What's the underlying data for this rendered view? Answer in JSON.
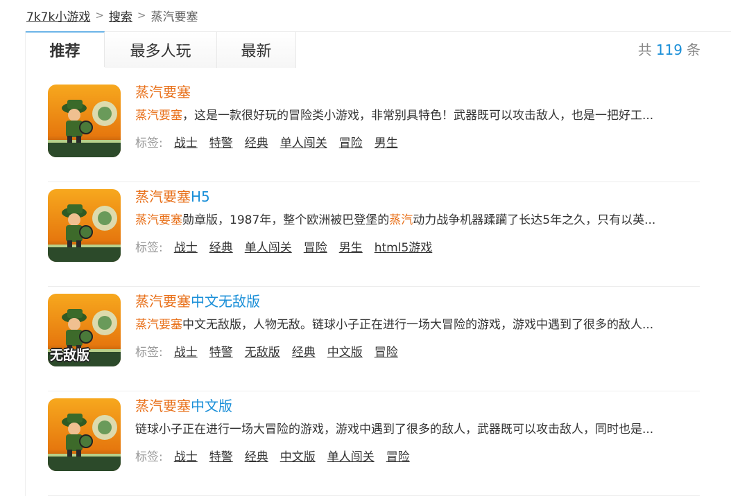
{
  "breadcrumb": {
    "home": "7k7k小游戏",
    "sep": ">",
    "search": "搜索",
    "current": "蒸汽要塞"
  },
  "tabs": [
    {
      "label": "推荐",
      "active": true
    },
    {
      "label": "最多人玩",
      "active": false
    },
    {
      "label": "最新",
      "active": false
    }
  ],
  "result_count": {
    "prefix": "共",
    "value": "119",
    "suffix": "条"
  },
  "tags_label": "标签:",
  "colors": {
    "highlight": "#e8701a",
    "link_blue": "#1a8fd8",
    "tab_accent": "#6cb4e8"
  },
  "games": [
    {
      "title_hl": "蒸汽要塞",
      "title_rest": "",
      "desc_parts": [
        {
          "text": "蒸汽要塞",
          "hl": true
        },
        {
          "text": "，这是一款很好玩的冒险类小游戏，非常别具特色！武器既可以攻击敌人，也是一把好工...",
          "hl": false
        }
      ],
      "tags": [
        "战士",
        "特警",
        "经典",
        "单人闯关",
        "冒险",
        "男生"
      ],
      "badge": ""
    },
    {
      "title_hl": "蒸汽要塞",
      "title_rest": "H5",
      "desc_parts": [
        {
          "text": "蒸汽要塞",
          "hl": true
        },
        {
          "text": "勋章版，1987年，整个欧洲被巴登堡的",
          "hl": false
        },
        {
          "text": "蒸汽",
          "hl": true
        },
        {
          "text": "动力战争机器蹂躏了长达5年之久，只有以英...",
          "hl": false
        }
      ],
      "tags": [
        "战士",
        "经典",
        "单人闯关",
        "冒险",
        "男生",
        "html5游戏"
      ],
      "badge": ""
    },
    {
      "title_hl": "蒸汽要塞",
      "title_rest": "中文无敌版",
      "desc_parts": [
        {
          "text": "蒸汽要塞",
          "hl": true
        },
        {
          "text": "中文无敌版，人物无敌。链球小子正在进行一场大冒险的游戏，游戏中遇到了很多的敌人...",
          "hl": false
        }
      ],
      "tags": [
        "战士",
        "特警",
        "无敌版",
        "经典",
        "中文版",
        "冒险"
      ],
      "badge": "无敌版"
    },
    {
      "title_hl": "蒸汽要塞",
      "title_rest": "中文版",
      "desc_parts": [
        {
          "text": "链球小子正在进行一场大冒险的游戏，游戏中遇到了很多的敌人，武器既可以攻击敌人，同时也是...",
          "hl": false
        }
      ],
      "tags": [
        "战士",
        "特警",
        "经典",
        "中文版",
        "单人闯关",
        "冒险"
      ],
      "badge": ""
    }
  ]
}
